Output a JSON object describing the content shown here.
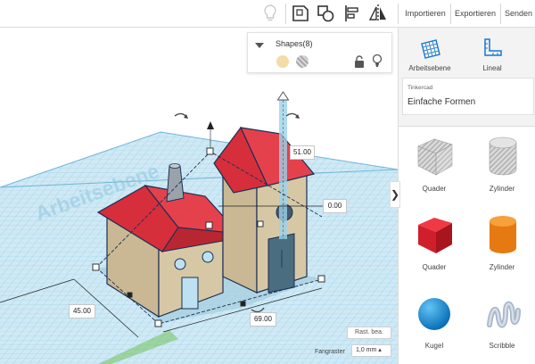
{
  "toolbar": {
    "import_label": "Importieren",
    "export_label": "Exportieren",
    "send_label": "Senden a",
    "icons": [
      "lightbulb-icon",
      "group-icon",
      "ungroup-icon",
      "align-icon",
      "mirror-icon"
    ]
  },
  "workplane": {
    "watermark": "Arbeitsebene",
    "grid_color": "#bde1f0",
    "dimensions": {
      "height": "51.00",
      "elevation": "0.00",
      "depth": "45.00",
      "width": "69.00"
    }
  },
  "inspector": {
    "title": "Shapes(8)",
    "solid_color": "#f3dca6"
  },
  "panel": {
    "workplane_label": "Arbeitsebene",
    "ruler_label": "Lineal",
    "library_category": "Tinkercad",
    "library_name": "Einfache Formen",
    "shapes": [
      {
        "label": "Quader",
        "kind": "box-hole"
      },
      {
        "label": "Zylinder",
        "kind": "cylinder-hole"
      },
      {
        "label": "Quader",
        "kind": "box-red"
      },
      {
        "label": "Zylinder",
        "kind": "cylinder-orange"
      },
      {
        "label": "Kugel",
        "kind": "sphere-blue"
      },
      {
        "label": "Scribble",
        "kind": "scribble"
      }
    ]
  },
  "footer": {
    "snap_edit": "Rast. bea.",
    "grid_label": "Fangraster",
    "grid_value": "1,0 mm ▴"
  },
  "colors": {
    "roof": "#e0323f",
    "wall": "#d7c8a5",
    "selection": "#1b2f55",
    "accent": "#1477d1"
  }
}
